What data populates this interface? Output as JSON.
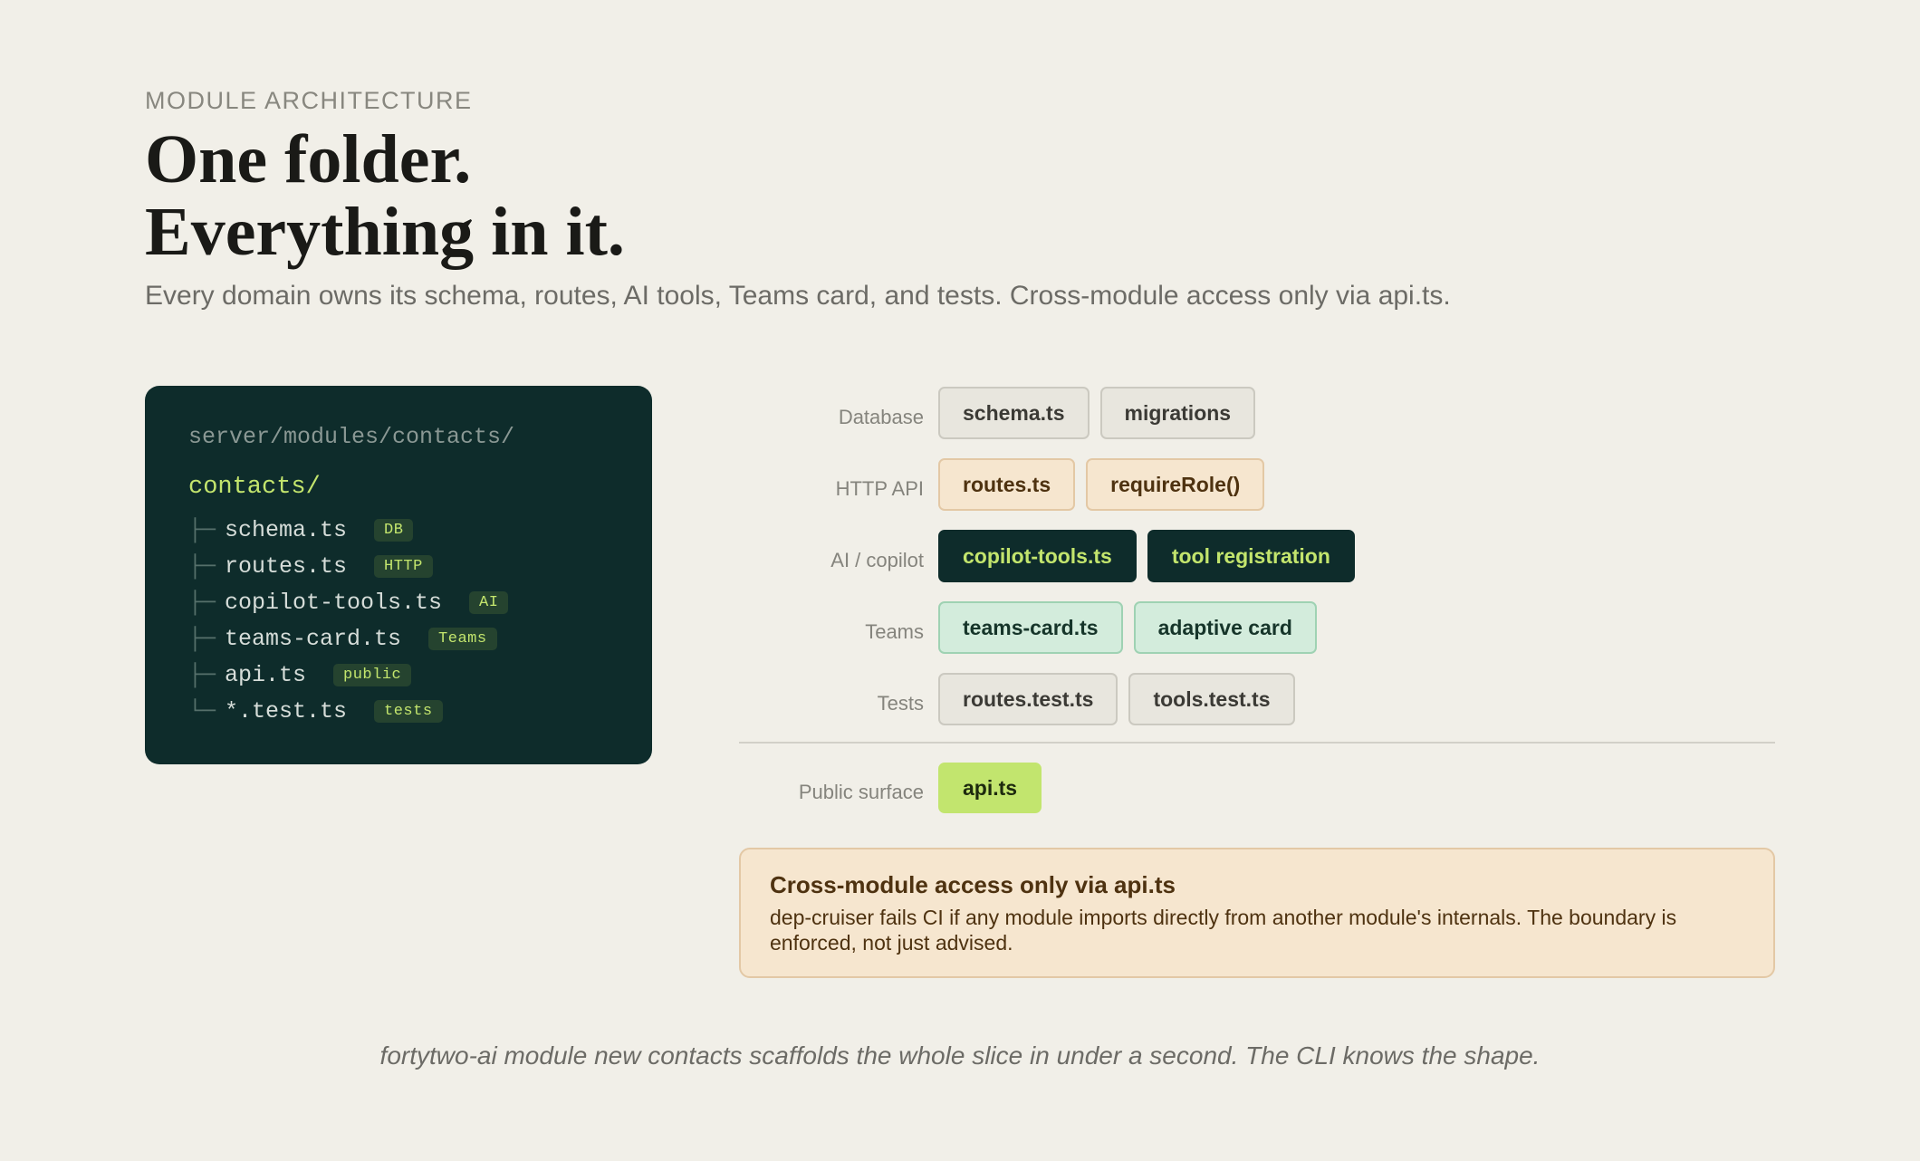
{
  "eyebrow": "MODULE ARCHITECTURE",
  "headline": {
    "line1": "One folder.",
    "line2": "Everything in it."
  },
  "subtitle": "Every domain owns its schema, routes, AI tools, Teams card, and tests. Cross-module access only via api.ts.",
  "tree": {
    "path": "server/modules/contacts/",
    "root": "contacts/",
    "items": [
      {
        "branch": "├─",
        "file": "schema.ts",
        "tag": "DB"
      },
      {
        "branch": "├─",
        "file": "routes.ts",
        "tag": "HTTP"
      },
      {
        "branch": "├─",
        "file": "copilot-tools.ts",
        "tag": "AI"
      },
      {
        "branch": "├─",
        "file": "teams-card.ts",
        "tag": "Teams"
      },
      {
        "branch": "├─",
        "file": "api.ts",
        "tag": "public"
      },
      {
        "branch": "└─",
        "file": "*.test.ts",
        "tag": "tests"
      }
    ]
  },
  "layers": {
    "database": {
      "label": "Database",
      "chips": [
        "schema.ts",
        "migrations"
      ]
    },
    "http": {
      "label": "HTTP API",
      "chips": [
        "routes.ts",
        "requireRole()"
      ]
    },
    "ai": {
      "label": "AI / copilot",
      "chips": [
        "copilot-tools.ts",
        "tool registration"
      ]
    },
    "teams": {
      "label": "Teams",
      "chips": [
        "teams-card.ts",
        "adaptive card"
      ]
    },
    "tests": {
      "label": "Tests",
      "chips": [
        "routes.test.ts",
        "tools.test.ts"
      ]
    },
    "public": {
      "label": "Public surface",
      "chips": [
        "api.ts"
      ]
    }
  },
  "callout": {
    "title": "Cross-module access only via api.ts",
    "body": "dep-cruiser fails CI if any module imports directly from another module's internals. The boundary is enforced, not just advised."
  },
  "footer": "fortytwo-ai module new contacts scaffolds the whole slice in under a second. The CLI knows the shape.",
  "colors": {
    "background": "#f1efe8",
    "panel": "#0e2c2b",
    "accent_lime": "#c2e56e",
    "peach": "#f6e6cf",
    "mint": "#d3ecdc"
  }
}
